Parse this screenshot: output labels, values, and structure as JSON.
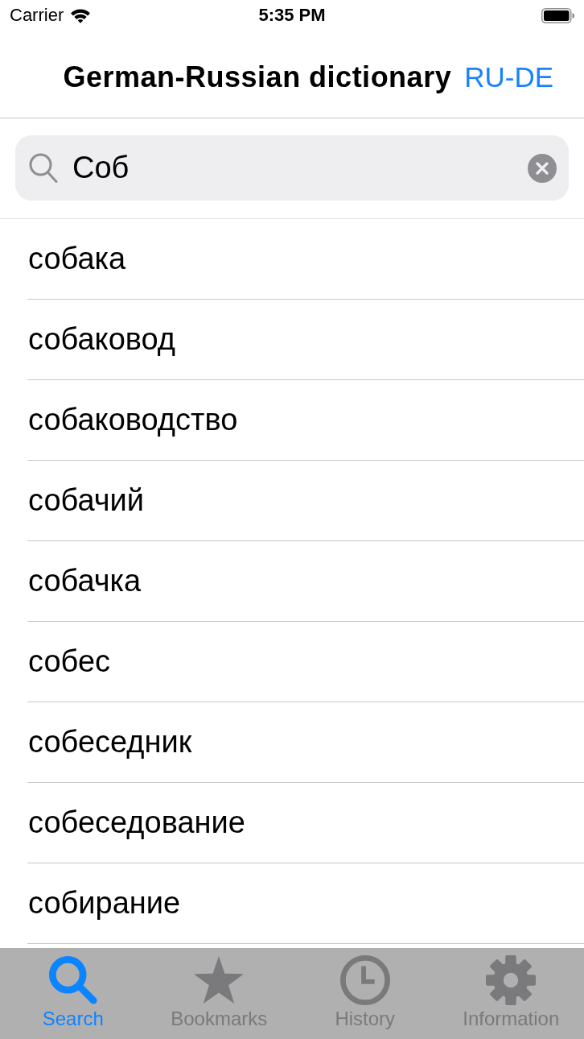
{
  "status_bar": {
    "carrier": "Carrier",
    "time": "5:35 PM"
  },
  "nav_bar": {
    "title": "German-Russian dictionary",
    "direction_button": "RU-DE"
  },
  "search": {
    "value": "Соб"
  },
  "results": [
    "собака",
    "собаковод",
    "собаководство",
    "собачий",
    "собачка",
    "собес",
    "собеседник",
    "собеседование",
    "собирание"
  ],
  "tab_bar": [
    {
      "label": "Search",
      "kind": "search",
      "selected": true
    },
    {
      "label": "Bookmarks",
      "kind": "bookmarks",
      "selected": false
    },
    {
      "label": "History",
      "kind": "history",
      "selected": false
    },
    {
      "label": "Information",
      "kind": "information",
      "selected": false
    }
  ]
}
